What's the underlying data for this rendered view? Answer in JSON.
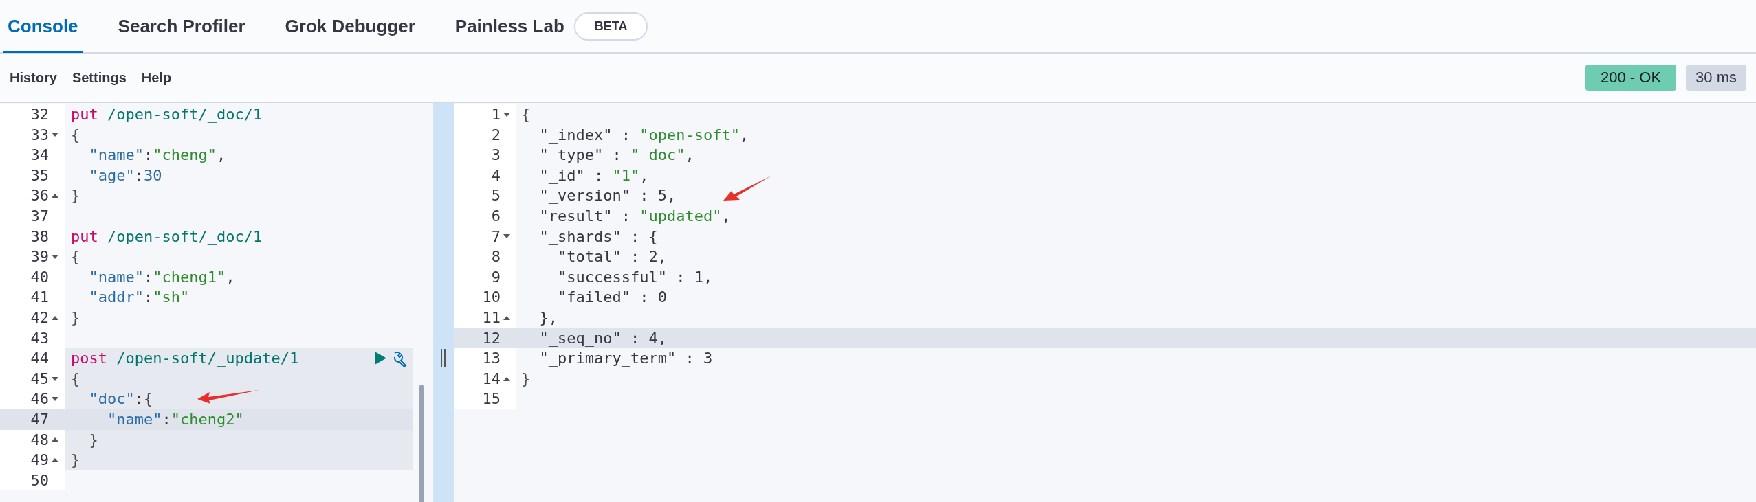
{
  "tabs": [
    {
      "label": "Console",
      "selected": true
    },
    {
      "label": "Search Profiler",
      "selected": false
    },
    {
      "label": "Grok Debugger",
      "selected": false
    },
    {
      "label": "Painless Lab",
      "selected": false,
      "badge": "BETA"
    }
  ],
  "toolbar": [
    "History",
    "Settings",
    "Help"
  ],
  "status": {
    "code": "200 - OK",
    "time": "30 ms"
  },
  "request_editor": {
    "lines": [
      {
        "number": "32",
        "tokens": [
          {
            "kind": "method",
            "text": "put"
          },
          {
            "kind": "path",
            "text": " /open-soft/_doc/1"
          }
        ]
      },
      {
        "number": "33",
        "fold_start": true,
        "tokens": [
          {
            "kind": "brace",
            "text": "{"
          }
        ]
      },
      {
        "number": "34",
        "tokens": [
          {
            "kind": "key",
            "text": "  \"name\""
          },
          {
            "kind": "punct",
            "text": ":"
          },
          {
            "kind": "string",
            "text": "\"cheng\""
          },
          {
            "kind": "punct",
            "text": ","
          }
        ]
      },
      {
        "number": "35",
        "tokens": [
          {
            "kind": "key",
            "text": "  \"age\""
          },
          {
            "kind": "punct",
            "text": ":"
          },
          {
            "kind": "number",
            "text": "30"
          }
        ]
      },
      {
        "number": "36",
        "fold_end": true,
        "tokens": [
          {
            "kind": "brace",
            "text": "}"
          }
        ]
      },
      {
        "number": "37"
      },
      {
        "number": "38",
        "tokens": [
          {
            "kind": "method",
            "text": "put"
          },
          {
            "kind": "path",
            "text": " /open-soft/_doc/1"
          }
        ]
      },
      {
        "number": "39",
        "fold_start": true,
        "tokens": [
          {
            "kind": "brace",
            "text": "{"
          }
        ]
      },
      {
        "number": "40",
        "tokens": [
          {
            "kind": "key",
            "text": "  \"name\""
          },
          {
            "kind": "punct",
            "text": ":"
          },
          {
            "kind": "string",
            "text": "\"cheng1\""
          },
          {
            "kind": "punct",
            "text": ","
          }
        ]
      },
      {
        "number": "41",
        "tokens": [
          {
            "kind": "key",
            "text": "  \"addr\""
          },
          {
            "kind": "punct",
            "text": ":"
          },
          {
            "kind": "string",
            "text": "\"sh\""
          }
        ]
      },
      {
        "number": "42",
        "fold_end": true,
        "tokens": [
          {
            "kind": "brace",
            "text": "}"
          }
        ]
      },
      {
        "number": "43"
      },
      {
        "number": "44",
        "in_request": true,
        "show_actions": true,
        "tokens": [
          {
            "kind": "method",
            "text": "post"
          },
          {
            "kind": "path",
            "text": " /open-soft/_update/1"
          }
        ]
      },
      {
        "number": "45",
        "in_request": true,
        "fold_start": true,
        "tokens": [
          {
            "kind": "brace",
            "text": "{"
          }
        ]
      },
      {
        "number": "46",
        "in_request": true,
        "fold_start": true,
        "tokens": [
          {
            "kind": "key",
            "text": "  \"doc\""
          },
          {
            "kind": "punct",
            "text": ":"
          },
          {
            "kind": "brace",
            "text": "{"
          }
        ]
      },
      {
        "number": "47",
        "in_request": true,
        "active": true,
        "tokens": [
          {
            "kind": "key",
            "text": "    \"name\""
          },
          {
            "kind": "punct",
            "text": ":"
          },
          {
            "kind": "string",
            "text": "\"cheng2\""
          }
        ]
      },
      {
        "number": "48",
        "in_request": true,
        "fold_end": true,
        "tokens": [
          {
            "kind": "brace",
            "text": "  }"
          }
        ]
      },
      {
        "number": "49",
        "in_request": true,
        "fold_end": true,
        "tokens": [
          {
            "kind": "brace",
            "text": "}"
          }
        ]
      },
      {
        "number": "50"
      }
    ]
  },
  "response_editor": {
    "lines": [
      {
        "number": "1",
        "fold_start": true,
        "tokens": [
          {
            "kind": "brace",
            "text": "{"
          }
        ]
      },
      {
        "number": "2",
        "tokens": [
          {
            "kind": "field",
            "text": "  \"_index\" : "
          },
          {
            "kind": "string",
            "text": "\"open-soft\""
          },
          {
            "kind": "field",
            "text": ","
          }
        ]
      },
      {
        "number": "3",
        "tokens": [
          {
            "kind": "field",
            "text": "  \"_type\" : "
          },
          {
            "kind": "string",
            "text": "\"_doc\""
          },
          {
            "kind": "field",
            "text": ","
          }
        ]
      },
      {
        "number": "4",
        "tokens": [
          {
            "kind": "field",
            "text": "  \"_id\" : "
          },
          {
            "kind": "string",
            "text": "\"1\""
          },
          {
            "kind": "field",
            "text": ","
          }
        ]
      },
      {
        "number": "5",
        "tokens": [
          {
            "kind": "field",
            "text": "  \"_version\" : 5,"
          }
        ]
      },
      {
        "number": "6",
        "tokens": [
          {
            "kind": "field",
            "text": "  \"result\" : "
          },
          {
            "kind": "string",
            "text": "\"updated\""
          },
          {
            "kind": "field",
            "text": ","
          }
        ]
      },
      {
        "number": "7",
        "fold_start": true,
        "tokens": [
          {
            "kind": "field",
            "text": "  \"_shards\" : {"
          }
        ]
      },
      {
        "number": "8",
        "tokens": [
          {
            "kind": "field",
            "text": "    \"total\" : 2,"
          }
        ]
      },
      {
        "number": "9",
        "tokens": [
          {
            "kind": "field",
            "text": "    \"successful\" : 1,"
          }
        ]
      },
      {
        "number": "10",
        "tokens": [
          {
            "kind": "field",
            "text": "    \"failed\" : 0"
          }
        ]
      },
      {
        "number": "11",
        "fold_end": true,
        "tokens": [
          {
            "kind": "field",
            "text": "  },"
          }
        ]
      },
      {
        "number": "12",
        "active": true,
        "tokens": [
          {
            "kind": "field",
            "text": "  \"_seq_no\" : 4,"
          }
        ]
      },
      {
        "number": "13",
        "tokens": [
          {
            "kind": "field",
            "text": "  \"_primary_term\" : 3"
          }
        ]
      },
      {
        "number": "14",
        "fold_end": true,
        "tokens": [
          {
            "kind": "brace",
            "text": "}"
          }
        ]
      },
      {
        "number": "15"
      }
    ]
  }
}
